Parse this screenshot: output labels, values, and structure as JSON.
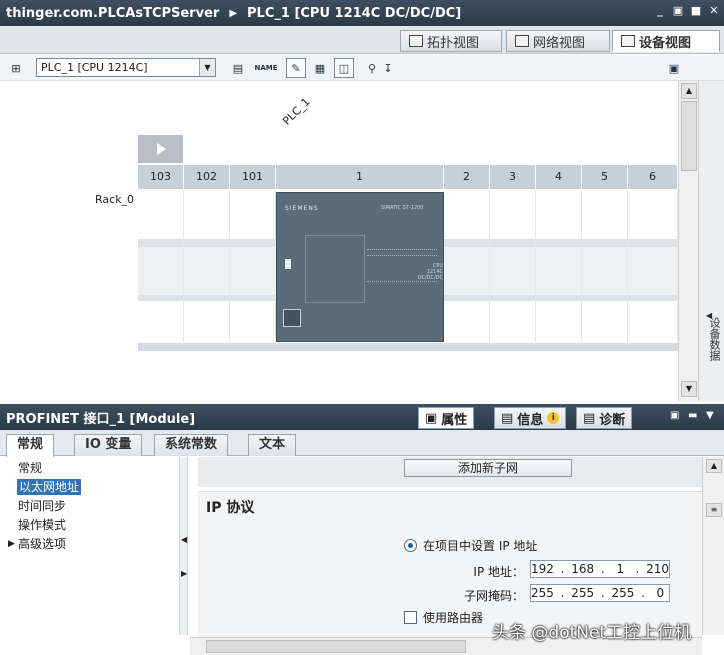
{
  "titlebar": {
    "project": "thinger.com.PLCAsTCPServer",
    "device": "PLC_1 [CPU 1214C DC/DC/DC]",
    "window_controls": [
      "_",
      "▣",
      "■",
      "✕"
    ]
  },
  "view_tabs": [
    {
      "label": "拓扑视图",
      "icon": "topology-icon",
      "active": false
    },
    {
      "label": "网络视图",
      "icon": "network-icon",
      "active": false
    },
    {
      "label": "设备视图",
      "icon": "device-icon",
      "active": true
    }
  ],
  "toolbar": {
    "device_select": "PLC_1 [CPU 1214C]",
    "name_icon_text": "NAME"
  },
  "canvas": {
    "plc_label": "PLC_1",
    "rack_label": "Rack_0",
    "slots": [
      "103",
      "102",
      "101",
      "1",
      "2",
      "3",
      "4",
      "5",
      "6"
    ],
    "cpu_brand": "SIEMENS",
    "cpu_model": "SIMATIC S7-1200",
    "cpu_variant": "CPU 1214C DC/DC/DC"
  },
  "side_tab": {
    "label": "设备数据"
  },
  "inspector": {
    "title": "PROFINET 接口_1 [Module]",
    "tabs": [
      {
        "label": "属性",
        "active": true
      },
      {
        "label": "信息",
        "active": false
      },
      {
        "label": "诊断",
        "active": false
      }
    ],
    "info_badge": "i",
    "sub_tabs": [
      {
        "label": "常规",
        "active": true
      },
      {
        "label": "IO 变量",
        "active": false
      },
      {
        "label": "系统常数",
        "active": false
      },
      {
        "label": "文本",
        "active": false
      }
    ]
  },
  "nav_tree": [
    {
      "label": "常规",
      "selected": false,
      "expandable": false
    },
    {
      "label": "以太网地址",
      "selected": true,
      "expandable": false
    },
    {
      "label": "时间同步",
      "selected": false,
      "expandable": false
    },
    {
      "label": "操作模式",
      "selected": false,
      "expandable": false
    },
    {
      "label": "高级选项",
      "selected": false,
      "expandable": true
    }
  ],
  "properties": {
    "add_subnet_button": "添加新子网",
    "section_title": "IP 协议",
    "radio_label": "在项目中设置 IP 地址",
    "ip_label": "IP 地址：",
    "ip_octets": [
      "192",
      "168",
      "1",
      "210"
    ],
    "mask_label": "子网掩码：",
    "mask_octets": [
      "255",
      "255",
      "255",
      "0"
    ],
    "router_label": "使用路由器"
  },
  "watermark": "头条 @dotNet工控上位机"
}
